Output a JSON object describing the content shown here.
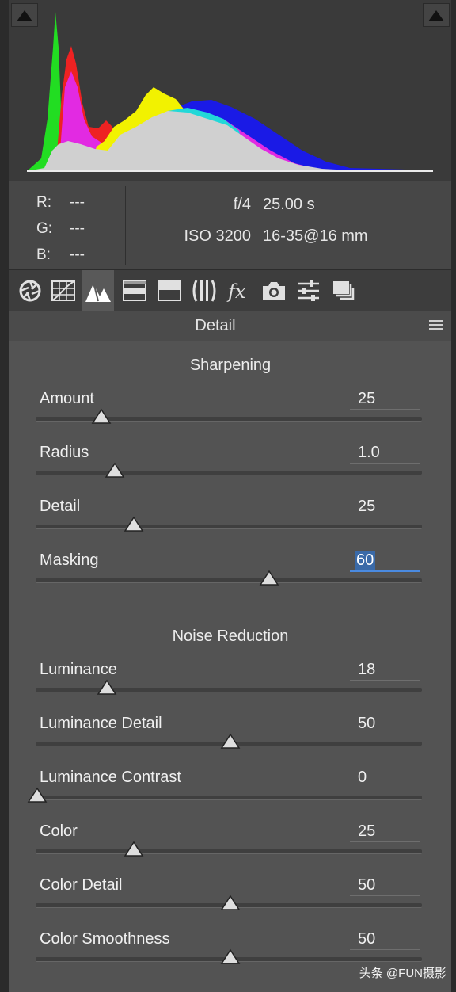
{
  "readout": {
    "r_label": "R:",
    "r_value": "---",
    "g_label": "G:",
    "g_value": "---",
    "b_label": "B:",
    "b_value": "---"
  },
  "exif": {
    "aperture": "f/4",
    "shutter": "25.00 s",
    "iso": "ISO 3200",
    "lens": "16-35@16 mm"
  },
  "toolbar": {
    "tools": [
      "basic",
      "tone-curve",
      "detail",
      "hsl",
      "split-toning",
      "lens-corrections",
      "effects",
      "camera-calibration",
      "presets",
      "snapshots"
    ],
    "active": "detail"
  },
  "panel": {
    "title": "Detail"
  },
  "sharpening": {
    "title": "Sharpening",
    "sliders": [
      {
        "label": "Amount",
        "value": "25",
        "min": 0,
        "max": 150
      },
      {
        "label": "Radius",
        "value": "1.0",
        "min": 0.5,
        "max": 3.0
      },
      {
        "label": "Detail",
        "value": "25",
        "min": 0,
        "max": 100
      },
      {
        "label": "Masking",
        "value": "60",
        "min": 0,
        "max": 100,
        "focused": true
      }
    ]
  },
  "noise_reduction": {
    "title": "Noise Reduction",
    "sliders": [
      {
        "label": "Luminance",
        "value": "18",
        "min": 0,
        "max": 100
      },
      {
        "label": "Luminance Detail",
        "value": "50",
        "min": 0,
        "max": 100
      },
      {
        "label": "Luminance Contrast",
        "value": "0",
        "min": 0,
        "max": 100
      },
      {
        "label": "Color",
        "value": "25",
        "min": 0,
        "max": 100
      },
      {
        "label": "Color Detail",
        "value": "50",
        "min": 0,
        "max": 100
      },
      {
        "label": "Color Smoothness",
        "value": "50",
        "min": 0,
        "max": 100
      }
    ]
  },
  "watermark": "头条 @FUN摄影",
  "colors": {
    "accent": "#4a8ae0",
    "panel": "#535353"
  }
}
